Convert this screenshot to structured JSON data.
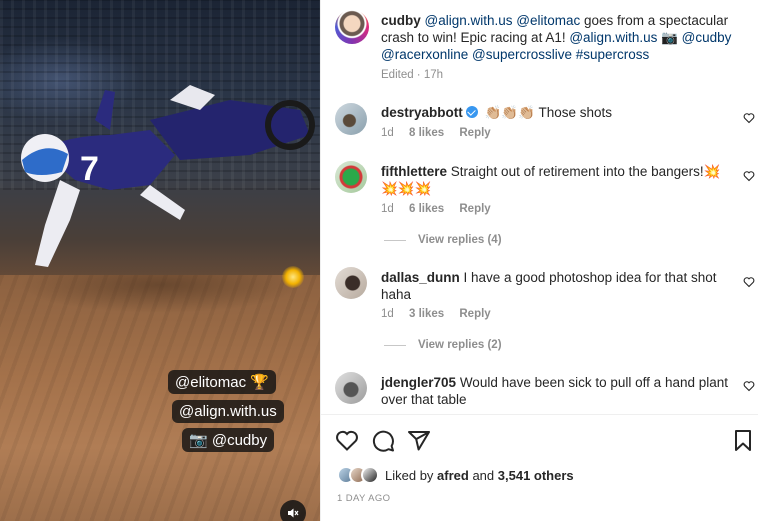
{
  "photo": {
    "stickers": [
      "@elitomac 🏆",
      "@align.with.us",
      "📷 @cudby"
    ],
    "mute_icon": "speaker-muted-icon"
  },
  "caption": {
    "user": "cudby",
    "text_parts": [
      {
        "t": "@align.with.us",
        "link": true
      },
      {
        "t": " ",
        "link": false
      },
      {
        "t": "@elitomac",
        "link": true
      },
      {
        "t": " goes from a spectacular crash to win! Epic racing at A1! ",
        "link": false
      },
      {
        "t": "@align.with.us",
        "link": true
      },
      {
        "t": " 📷 ",
        "link": false
      },
      {
        "t": "@cudby",
        "link": true
      },
      {
        "t": " ",
        "link": false
      },
      {
        "t": "@racerxonline",
        "link": true
      },
      {
        "t": " ",
        "link": false
      },
      {
        "t": "@supercrosslive",
        "link": true
      },
      {
        "t": " ",
        "link": false
      },
      {
        "t": "#supercross",
        "link": true
      }
    ],
    "meta": "Edited · 17h"
  },
  "comments": [
    {
      "user": "destryabbott",
      "verified": true,
      "text": "👏🏼👏🏼👏🏼 Those shots",
      "age": "1d",
      "likes": "8 likes",
      "reply": "Reply"
    },
    {
      "user": "fifthlettere",
      "verified": false,
      "text": "Straight out of retirement into the bangers!💥💥💥💥",
      "age": "1d",
      "likes": "6 likes",
      "reply": "Reply",
      "view_replies": "View replies (4)"
    },
    {
      "user": "dallas_dunn",
      "verified": false,
      "text": "I have a good photoshop idea for that shot haha",
      "age": "1d",
      "likes": "3 likes",
      "reply": "Reply",
      "view_replies": "View replies (2)"
    },
    {
      "user": "jdengler705",
      "verified": false,
      "text": "Would have been sick to pull off a hand plant over that table"
    }
  ],
  "actions": {
    "icons": [
      "heart-icon",
      "comment-icon",
      "share-icon",
      "bookmark-icon"
    ]
  },
  "likes": {
    "prefix": "Liked by ",
    "user": "afred",
    "middle": " and ",
    "count": "3,541 others"
  },
  "timestamp": "1 DAY AGO"
}
